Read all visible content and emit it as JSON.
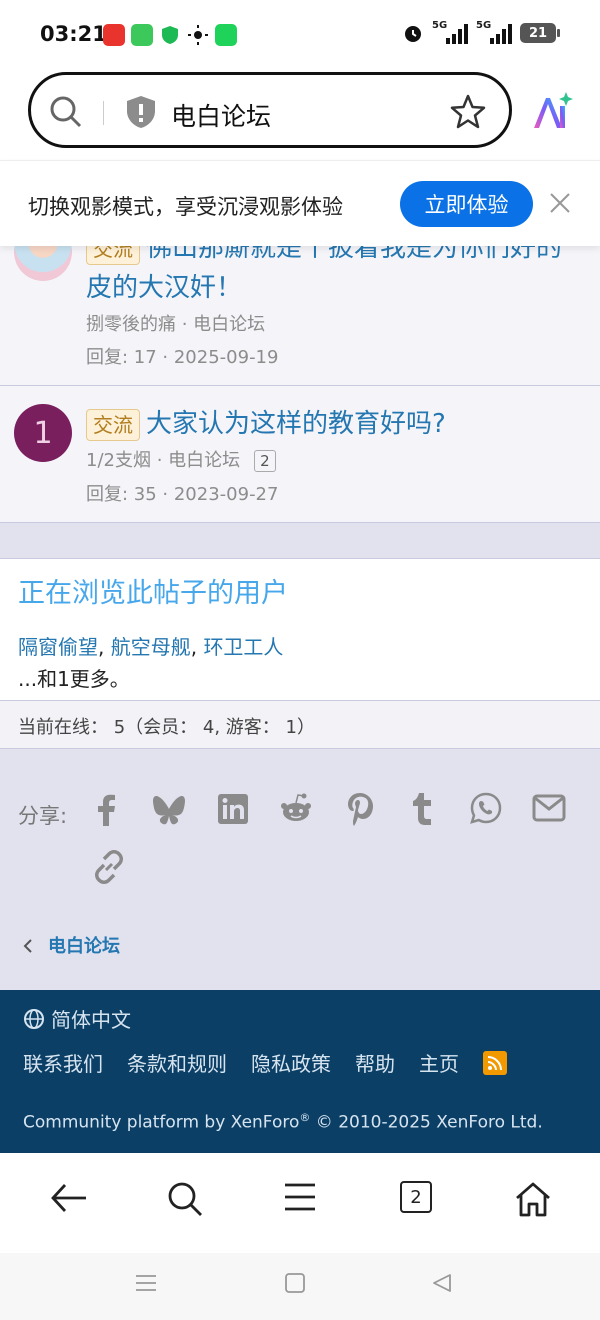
{
  "status_bar": {
    "time": "03:21",
    "signal1_label": "5G",
    "signal2_label": "5G",
    "battery": "21",
    "icons": [
      "app-icon-red",
      "messages-icon",
      "shield-icon",
      "brightness-icon",
      "wechat-icon",
      "alarm-icon",
      "vibrate-icon"
    ]
  },
  "address_bar": {
    "text": "电白论坛",
    "icons": [
      "search-icon",
      "shield-icon",
      "star-icon",
      "ai-assistant-icon"
    ]
  },
  "promo": {
    "text": "切换观影模式，享受沉浸观影体验",
    "button": "立即体验",
    "accent_color": "#0a72e6"
  },
  "threads": [
    {
      "tag": "交流",
      "title": "佛山那厮就是个披着我是为你们好的皮的大汉奸！",
      "author_forum": "捌零後的痛 · 电白论坛",
      "replies_date": "回复: 17 · 2025-09-19"
    },
    {
      "tag": "交流",
      "title": "大家认为这样的教育好吗?",
      "avatar_letter": "1",
      "author_forum": "1/2支烟 · 电白论坛",
      "page_badge": "2",
      "replies_date": "回复: 35 · 2023-09-27"
    }
  ],
  "viewers": {
    "title": "正在浏览此帖子的用户",
    "users": [
      "隔窗偷望",
      "航空母舰",
      "环卫工人"
    ],
    "more": "...和1更多。"
  },
  "online": {
    "text": "当前在线： 5（会员： 4, 游客： 1）"
  },
  "share": {
    "label": "分享:",
    "icons": [
      "facebook-icon",
      "bluesky-icon",
      "linkedin-icon",
      "reddit-icon",
      "pinterest-icon",
      "tumblr-icon",
      "whatsapp-icon",
      "email-icon",
      "link-icon"
    ]
  },
  "breadcrumb": {
    "label": "电白论坛"
  },
  "footer": {
    "language": "简体中文",
    "links": [
      "联系我们",
      "条款和规则",
      "隐私政策",
      "帮助",
      "主页"
    ],
    "copyright_prefix": "Community platform by XenForo",
    "registered": "®",
    "copyright_suffix": " © 2010-2025 XenForo Ltd.",
    "background": "#0c3f66"
  },
  "browser_nav": {
    "tab_count": "2",
    "icons": [
      "back-arrow-icon",
      "search-icon",
      "menu-icon",
      "tabs-icon",
      "home-icon"
    ]
  },
  "system_nav": {
    "icons": [
      "recents-icon",
      "home-button-icon",
      "back-triangle-icon"
    ]
  }
}
